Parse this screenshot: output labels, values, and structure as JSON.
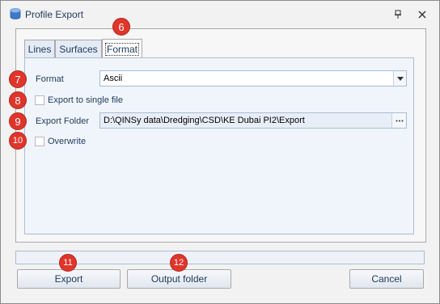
{
  "window": {
    "title": "Profile Export"
  },
  "tabs": [
    {
      "label": "Lines"
    },
    {
      "label": "Surfaces"
    },
    {
      "label": "Format"
    }
  ],
  "format": {
    "label": "Format",
    "value": "Ascii",
    "export_single_label": "Export to single file",
    "export_single_checked": false,
    "folder_label": "Export Folder",
    "folder_value": "D:\\QINSy data\\Dredging\\CSD\\KE Dubai PI2\\Export",
    "overwrite_label": "Overwrite",
    "overwrite_checked": false
  },
  "progress": {
    "percent": 0
  },
  "buttons": {
    "export": "Export",
    "output_folder": "Output folder",
    "cancel": "Cancel"
  },
  "badges": [
    "6",
    "7",
    "8",
    "9",
    "10",
    "11",
    "12"
  ],
  "colors": {
    "badge": "#e0352b",
    "text": "#1e395b",
    "panel_bg": "#f0f5fb"
  },
  "icons": {
    "app": "database-icon",
    "pin": "pin-icon",
    "close": "close-icon",
    "dropdown": "chevron-down-icon",
    "browse": "ellipsis-icon"
  }
}
